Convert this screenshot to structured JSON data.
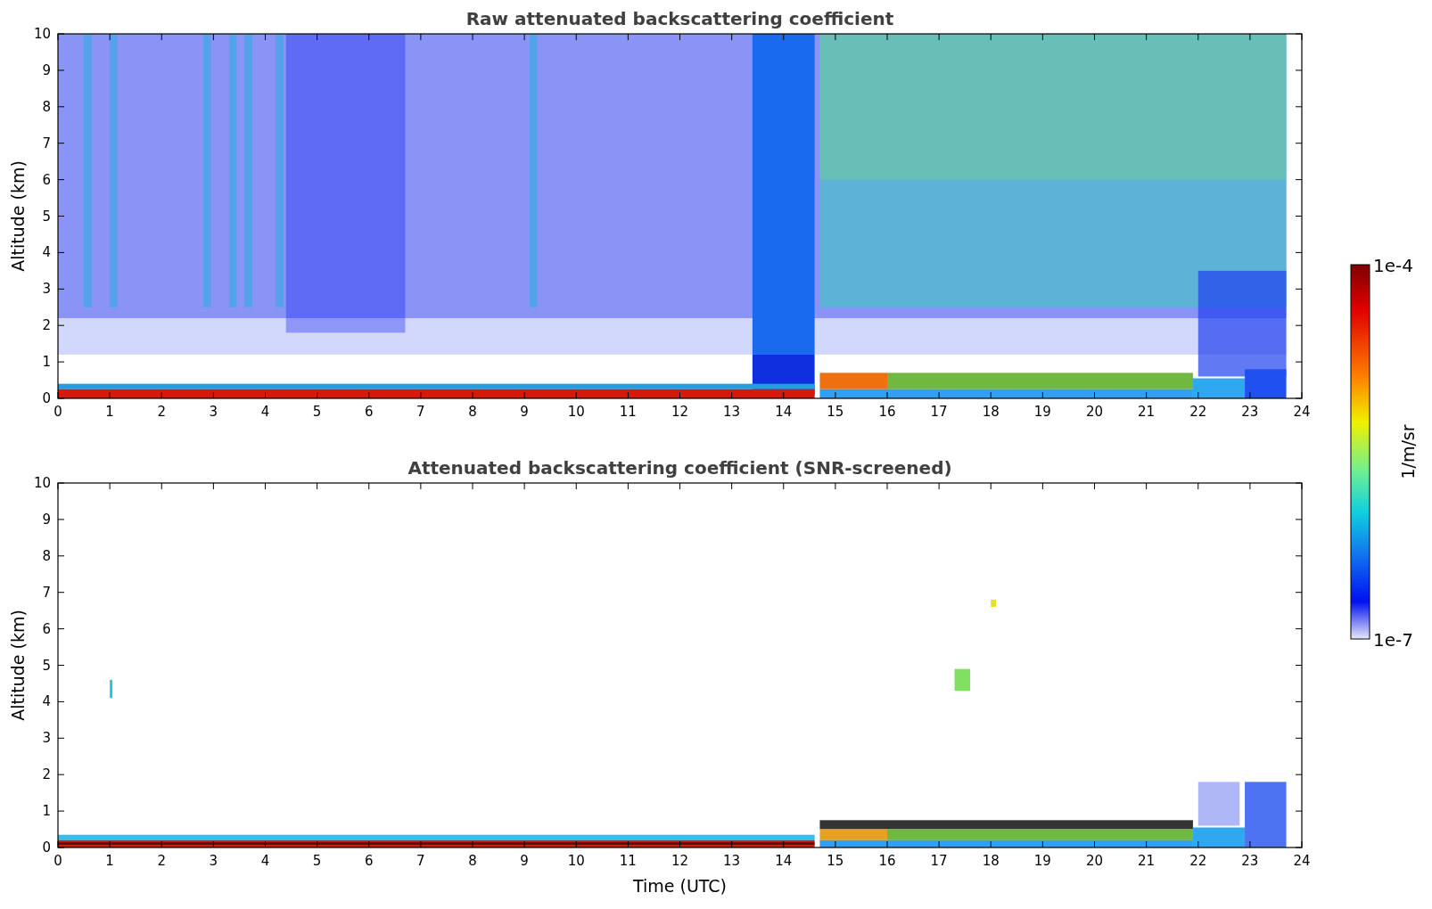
{
  "panels": [
    {
      "title": "Raw attenuated backscattering coefficient",
      "ylabel": "Altitude (km)",
      "yticks": [
        "10",
        "9",
        "8",
        "7",
        "6",
        "5",
        "4",
        "3",
        "2",
        "1",
        "0"
      ],
      "xticks": [
        "0",
        "1",
        "2",
        "3",
        "4",
        "5",
        "6",
        "7",
        "8",
        "9",
        "10",
        "11",
        "12",
        "13",
        "14",
        "15",
        "16",
        "17",
        "18",
        "19",
        "20",
        "21",
        "22",
        "23",
        "24"
      ],
      "kind": "raw"
    },
    {
      "title": "Attenuated backscattering coefficient (SNR-screened)",
      "ylabel": "Altitude (km)",
      "xlabel": "Time (UTC)",
      "yticks": [
        "10",
        "9",
        "8",
        "7",
        "6",
        "5",
        "4",
        "3",
        "2",
        "1",
        "0"
      ],
      "xticks": [
        "0",
        "1",
        "2",
        "3",
        "4",
        "5",
        "6",
        "7",
        "8",
        "9",
        "10",
        "11",
        "12",
        "13",
        "14",
        "15",
        "16",
        "17",
        "18",
        "19",
        "20",
        "21",
        "22",
        "23",
        "24"
      ],
      "kind": "screened"
    }
  ],
  "colorbar": {
    "label": "1/m/sr",
    "max_label": "1e-4",
    "min_label": "1e-7"
  }
}
